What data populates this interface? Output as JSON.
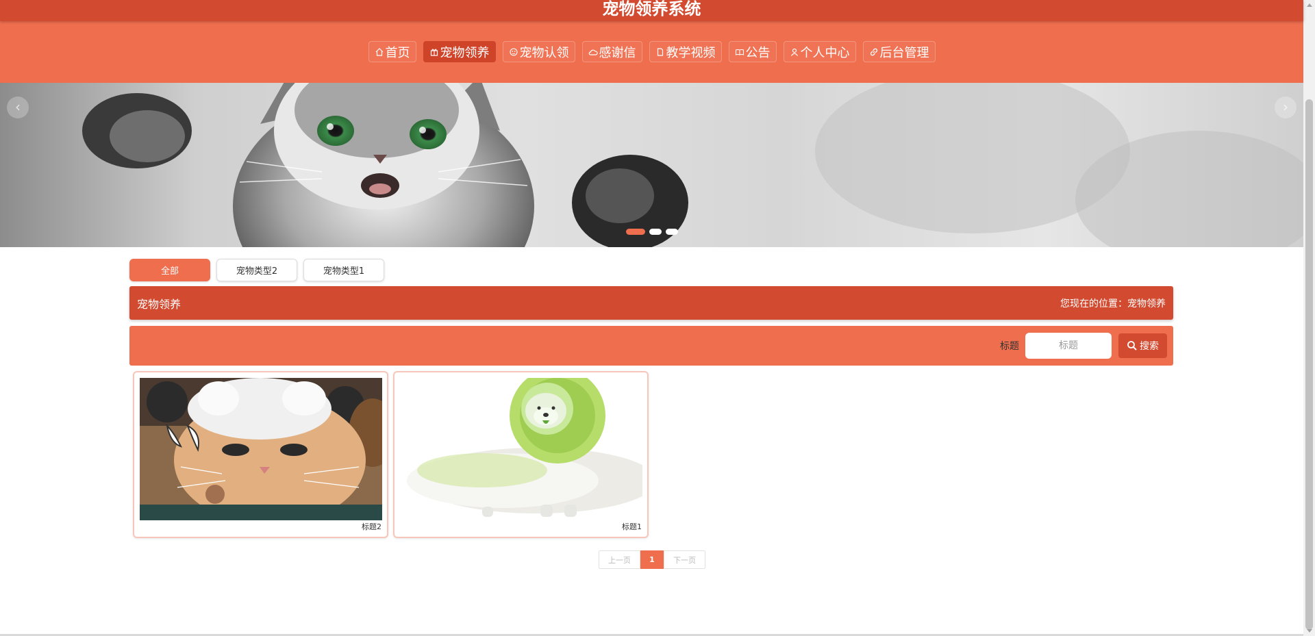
{
  "header": {
    "title": "宠物领养系统"
  },
  "nav": {
    "items": [
      {
        "label": "首页",
        "icon": "home-icon"
      },
      {
        "label": "宠物领养",
        "icon": "gift-icon",
        "active": true
      },
      {
        "label": "宠物认领",
        "icon": "paw-icon"
      },
      {
        "label": "感谢信",
        "icon": "cloud-icon"
      },
      {
        "label": "教学视频",
        "icon": "file-icon"
      },
      {
        "label": "公告",
        "icon": "book-icon"
      },
      {
        "label": "个人中心",
        "icon": "user-icon"
      },
      {
        "label": "后台管理",
        "icon": "link-icon"
      }
    ]
  },
  "banner": {
    "arrow_left": "‹",
    "arrow_right": "›",
    "active_slide": 1,
    "slide_count": 3
  },
  "categories": {
    "items": [
      "全部",
      "宠物类型2",
      "宠物类型1"
    ],
    "active_index": 0
  },
  "section": {
    "title": "宠物领养",
    "breadcrumb": "您现在的位置：宠物领养"
  },
  "search": {
    "label": "标题",
    "placeholder": "标题",
    "value": "",
    "button_label": "搜索"
  },
  "cards": [
    {
      "caption": "标题2",
      "image": "cat-with-hat"
    },
    {
      "caption": "标题1",
      "image": "cabbage-dog"
    }
  ],
  "pagination": {
    "prev": "上一页",
    "current": "1",
    "next": "下一页"
  },
  "colors": {
    "primary": "#ef6e4e",
    "primary_dark": "#d24a2f"
  }
}
